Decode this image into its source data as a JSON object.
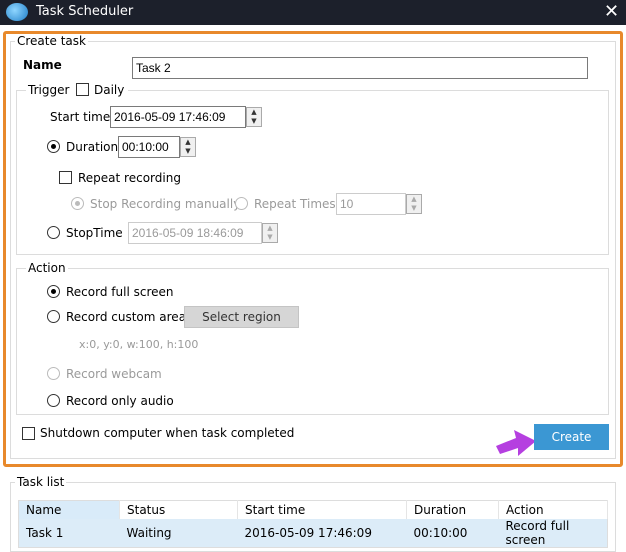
{
  "window": {
    "title": "Task Scheduler"
  },
  "create_task": {
    "group_label": "Create task",
    "name_label": "Name",
    "name_value": "Task 2",
    "trigger": {
      "label": "Trigger",
      "daily_label": "Daily",
      "daily_checked": false,
      "start_time_label": "Start time",
      "start_time": "2016-05-09 17:46:09",
      "duration_label": "Duration",
      "duration": "00:10:00",
      "duration_selected": true,
      "repeat_label": "Repeat recording",
      "repeat_checked": false,
      "stop_manually_label": "Stop Recording manually",
      "repeat_times_label": "Repeat Times",
      "repeat_times": "10",
      "stop_time_label": "StopTime",
      "stop_time": "2016-05-09 18:46:09"
    },
    "action": {
      "label": "Action",
      "full_screen": "Record full screen",
      "custom_area": "Record custom area",
      "select_region": "Select region",
      "region": "x:0, y:0, w:100, h:100",
      "webcam": "Record webcam",
      "audio": "Record only audio",
      "selected": "Record full screen"
    },
    "shutdown_label": "Shutdown computer when task completed",
    "shutdown_checked": false,
    "create_button": "Create"
  },
  "task_list": {
    "label": "Task list",
    "columns": [
      "Name",
      "Status",
      "Start time",
      "Duration",
      "Action"
    ],
    "rows": [
      [
        "Task 1",
        "Waiting",
        "2016-05-09 17:46:09",
        "00:10:00",
        "Record full screen"
      ]
    ]
  },
  "colors": {
    "highlight": "#e8892b",
    "accent": "#3b97d3",
    "arrow": "#b53fe0"
  }
}
